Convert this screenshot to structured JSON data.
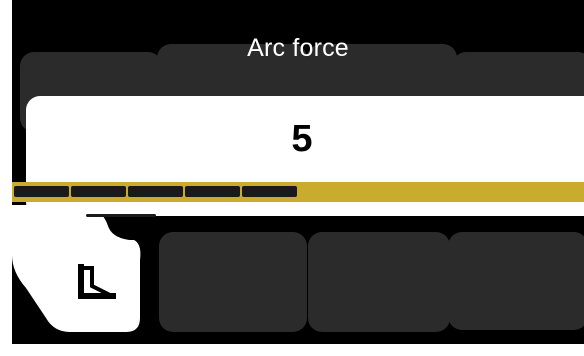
{
  "screen": {
    "title": "Arc force",
    "value": "5"
  },
  "slider": {
    "level_fraction": 0.5,
    "segments_filled": 5,
    "accent_color": "#c9ac2d",
    "fill_color": "#1a1a1a"
  },
  "icons": {
    "tool": "arc-force-icon"
  }
}
